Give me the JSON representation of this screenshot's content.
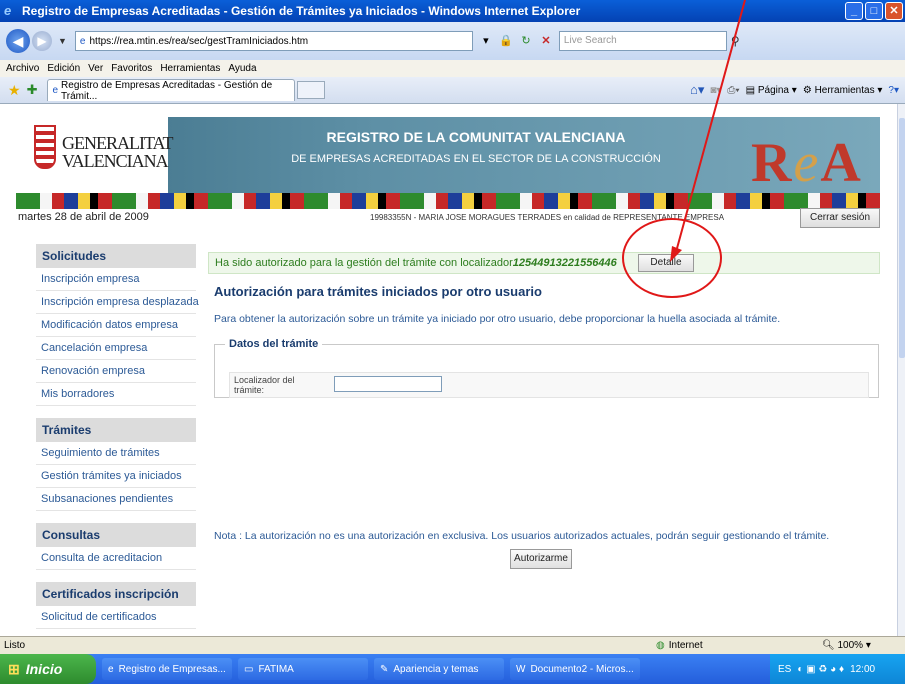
{
  "window": {
    "title": "Registro de Empresas Acreditadas - Gestión de Trámites ya Iniciados - Windows Internet Explorer",
    "url": "https://rea.mtin.es/rea/sec/gestTramIniciados.htm",
    "search_placeholder": "Live Search"
  },
  "menu": [
    "Archivo",
    "Edición",
    "Ver",
    "Favoritos",
    "Herramientas",
    "Ayuda"
  ],
  "tab": {
    "title": "Registro de Empresas Acreditadas - Gestión de Trámit..."
  },
  "command_bar": {
    "page": "Página",
    "tools": "Herramientas"
  },
  "banner": {
    "logo_line1": "GENERALITAT",
    "logo_line2": "VALENCIANA",
    "title": "REGISTRO DE LA COMUNITAT VALENCIANA",
    "subtitle": "DE EMPRESAS ACREDITADAS EN EL SECTOR DE LA CONSTRUCCIÓN",
    "rea_r": "R",
    "rea_e": "e",
    "rea_a": "A"
  },
  "session": {
    "date": "martes 28 de abril de 2009",
    "user": "19983355N - MARIA JOSE MORAGUES TERRADES en calidad de REPRESENTANTE EMPRESA",
    "logout": "Cerrar sesión"
  },
  "sidebar": [
    {
      "heading": "Solicitudes",
      "items": [
        "Inscripción empresa",
        "Inscripción empresa desplazada",
        "Modificación datos empresa",
        "Cancelación empresa",
        "Renovación empresa",
        "Mis borradores"
      ]
    },
    {
      "heading": "Trámites",
      "items": [
        "Seguimiento de trámites",
        "Gestión trámites ya iniciados",
        "Subsanaciones pendientes"
      ]
    },
    {
      "heading": "Consultas",
      "items": [
        "Consulta de acreditacion"
      ]
    },
    {
      "heading": "Certificados inscripción",
      "items": [
        "Solicitud de certificados"
      ]
    }
  ],
  "content": {
    "auth_message": "Ha sido autorizado para la gestión del trámite con localizador",
    "localizador": "12544913221556446",
    "detail_button": "Detalle",
    "title": "Autorización para trámites iniciados por otro usuario",
    "intro": "Para obtener la autorización sobre un trámite ya iniciado por otro usuario, debe proporcionar la huella asociada al trámite.",
    "fieldset_legend": "Datos del trámite",
    "field_label": "Localizador del trámite:",
    "field_value": "",
    "note": "Nota : La autorización no es una autorización en exclusiva. Los usuarios autorizados actuales, podrán seguir gestionando el trámite.",
    "authorize_button": "Autorizarme"
  },
  "status": {
    "text": "Listo",
    "zone": "Internet",
    "zoom": "100%"
  },
  "taskbar": {
    "start": "Inicio",
    "tasks": [
      "Registro de Empresas...",
      "FATIMA",
      "Apariencia y temas",
      "Documento2 - Micros..."
    ],
    "tray_lang": "ES",
    "clock": "12:00"
  },
  "colors": {
    "annotation": "#e01818",
    "link": "#2c5a96",
    "heading": "#1a3c6e",
    "success": "#2d7d1e"
  }
}
